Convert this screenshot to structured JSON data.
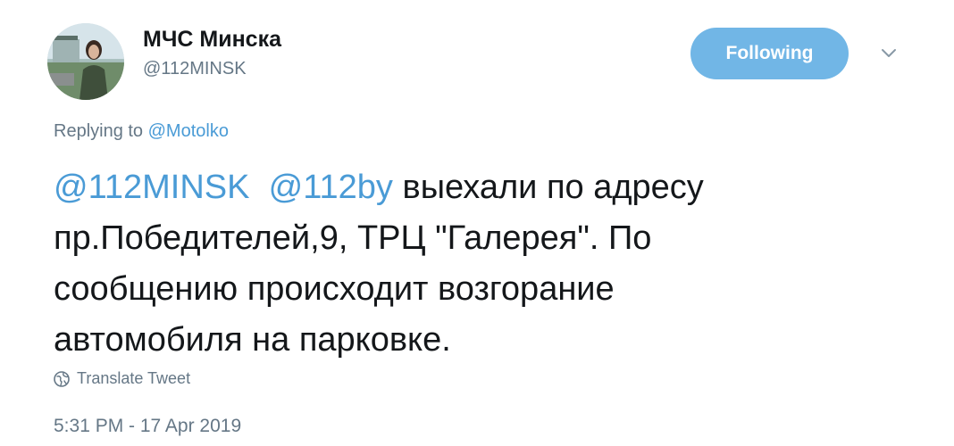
{
  "author": {
    "display_name": "МЧС Минска",
    "handle": "@112MINSK"
  },
  "follow_button": {
    "label": "Following"
  },
  "reply": {
    "prefix": "Replying to",
    "to": "@Motolko"
  },
  "tweet": {
    "mentions": [
      "@112MINSK",
      "@112by"
    ],
    "line1_rest": "выехали по адресу",
    "line2": "пр.Победителей,9, ТРЦ \"Галерея\". По",
    "line3": "сообщению происходит возгорание",
    "line4": "автомобиля на парковке."
  },
  "translate": {
    "label": "Translate Tweet",
    "icon": "globe-icon"
  },
  "timestamp": "5:31 PM - 17 Apr 2019",
  "colors": {
    "accent": "#4a9bd6",
    "button_bg": "#71b6e6",
    "secondary_text": "#657786"
  }
}
